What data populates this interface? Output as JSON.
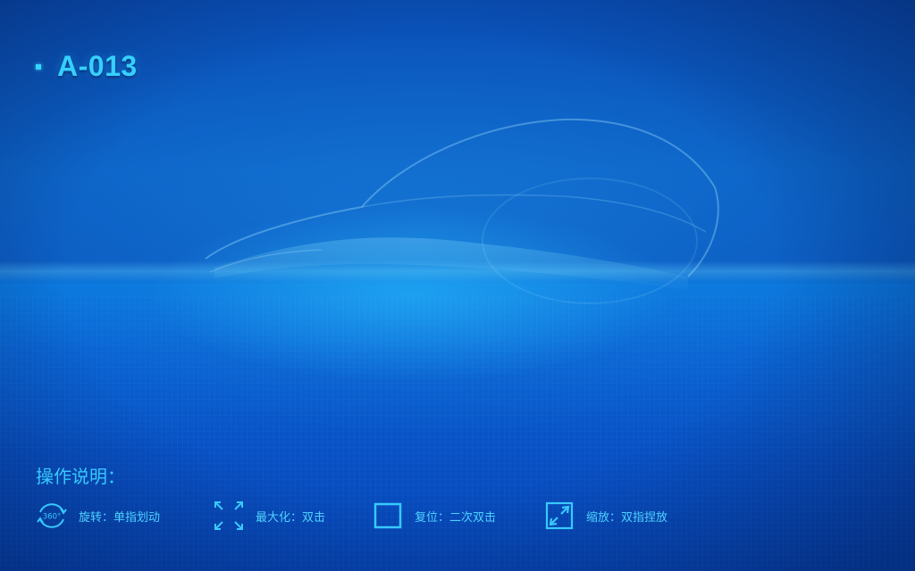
{
  "header": {
    "title": "A-013"
  },
  "help": {
    "title": "操作说明：",
    "items": [
      {
        "icon": "rotate-360-icon",
        "icon_text": "360°",
        "label": "旋转：单指划动"
      },
      {
        "icon": "maximize-icon",
        "label": "最大化：双击"
      },
      {
        "icon": "reset-square-icon",
        "label": "复位：二次双击"
      },
      {
        "icon": "zoom-icon",
        "label": "缩放：双指捏放"
      }
    ]
  },
  "colors": {
    "accent": "#35d0ff",
    "background": "#0a5cc4"
  }
}
